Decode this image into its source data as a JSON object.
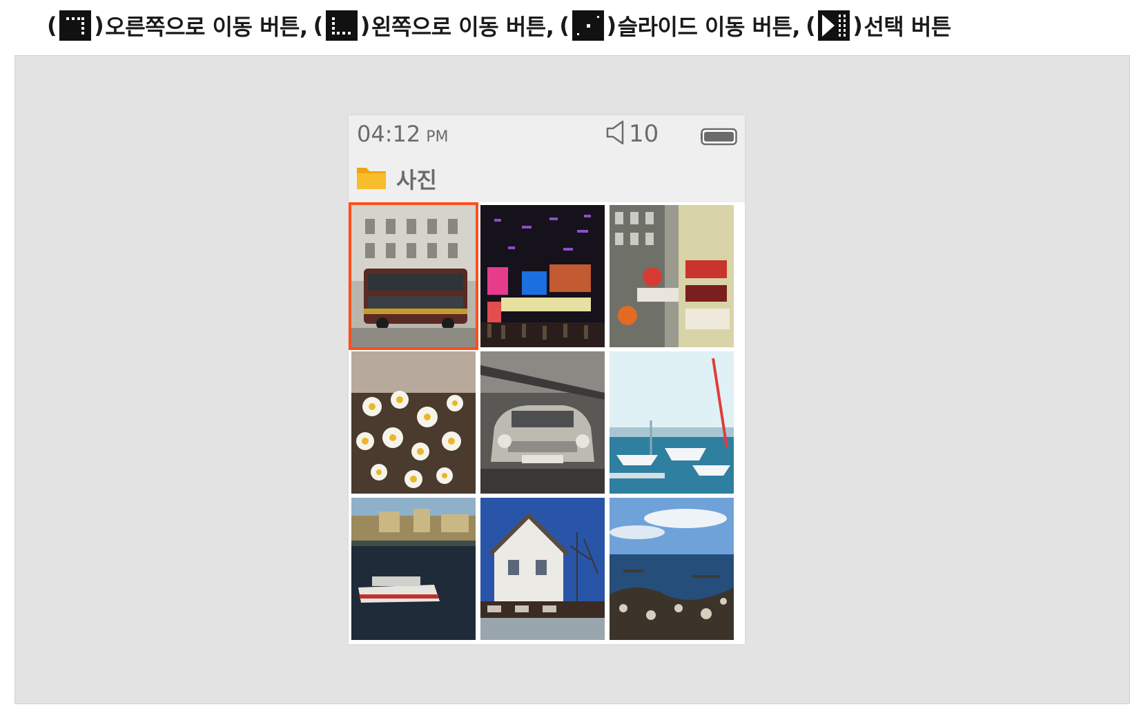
{
  "legend": {
    "items": [
      {
        "key": "right-key",
        "label": "오른쪽으로 이동 버튼,"
      },
      {
        "key": "left-key",
        "label": "왼쪽으로 이동 버튼,"
      },
      {
        "key": "slide-key",
        "label": "슬라이드 이동 버튼,"
      },
      {
        "key": "select-key",
        "label": "선택 버튼"
      }
    ]
  },
  "status": {
    "time": "04:12",
    "ampm": "PM",
    "volume": "10"
  },
  "folder": {
    "name": "사진"
  },
  "photos": [
    {
      "subject": "double-decker bus",
      "selected": true
    },
    {
      "subject": "night city neon"
    },
    {
      "subject": "building signs"
    },
    {
      "subject": "daisies"
    },
    {
      "subject": "old car"
    },
    {
      "subject": "marina"
    },
    {
      "subject": "river ferry"
    },
    {
      "subject": "seaside house"
    },
    {
      "subject": "rocky coast"
    }
  ],
  "colors": {
    "selection": "#ff4e1a",
    "panel_bg": "#e3e3e3",
    "folder": "#f6b21b"
  }
}
